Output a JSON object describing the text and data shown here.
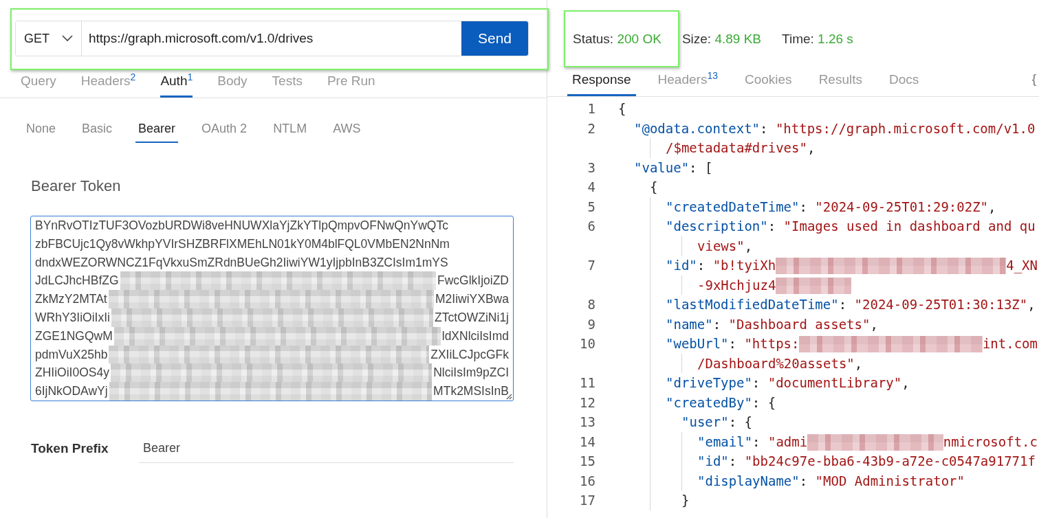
{
  "request": {
    "method": "GET",
    "url": "https://graph.microsoft.com/v1.0/drives",
    "send_label": "Send"
  },
  "request_tabs": [
    {
      "label": "Query",
      "selected": false
    },
    {
      "label": "Headers",
      "badge": "2",
      "selected": false
    },
    {
      "label": "Auth",
      "badge": "1",
      "selected": true
    },
    {
      "label": "Body",
      "selected": false
    },
    {
      "label": "Tests",
      "selected": false
    },
    {
      "label": "Pre Run",
      "selected": false
    }
  ],
  "auth_types": [
    {
      "label": "None",
      "selected": false
    },
    {
      "label": "Basic",
      "selected": false
    },
    {
      "label": "Bearer",
      "selected": true
    },
    {
      "label": "OAuth 2",
      "selected": false
    },
    {
      "label": "NTLM",
      "selected": false
    },
    {
      "label": "AWS",
      "selected": false
    }
  ],
  "bearer": {
    "label": "Bearer Token",
    "token_lines": [
      {
        "text": "BYnRvOTIzTUF3OVozbURDWi8veHNUWXlaYjZkYTlpQmpvOFNwQnYwQTc"
      },
      {
        "text": "zbFBCUjc1Qy8vWkhpYVIrSHZBRFlXMEhLN01kY0M4blFQL0VMbEN2NnNm"
      },
      {
        "text": "dndxWEZORWNCZ1FqVkxuSmZRdnBUeGh2IiwiYW1yIjpbInB3ZCIsIm1mYS"
      },
      {
        "start": "JdLCJhcHBfZG",
        "end": "FwcGlkIjoiZD"
      },
      {
        "start": "ZkMzY2MTAt",
        "end": "M2IiwiYXBwa"
      },
      {
        "start": "WRhY3IiOiIxIi",
        "end": "ZTctOWZiNi1j"
      },
      {
        "start": "ZGE1NGQwM",
        "end": "ldXNlciIsImd"
      },
      {
        "start": "pdmVuX25hb",
        "end": "ZXIiLCJpcGFk"
      },
      {
        "start": "ZHIiOiI0OS4y",
        "end": "NlciIsIm9pZCI"
      },
      {
        "start": "6IjNkODAwYj",
        "end": "MTk2MSIsInB"
      }
    ],
    "prefix_label": "Token Prefix",
    "prefix_value": "Bearer"
  },
  "response": {
    "stats": [
      {
        "label": "Status:",
        "value": "200 OK"
      },
      {
        "label": "Size:",
        "value": "4.89 KB"
      },
      {
        "label": "Time:",
        "value": "1.26 s"
      }
    ],
    "tabs": [
      {
        "label": "Response",
        "selected": true
      },
      {
        "label": "Headers",
        "badge": "13",
        "selected": false
      },
      {
        "label": "Cookies",
        "selected": false
      },
      {
        "label": "Results",
        "selected": false
      },
      {
        "label": "Docs",
        "selected": false
      }
    ],
    "format_button": "{",
    "lines": [
      {
        "num": "1",
        "tokens": [
          {
            "kind": "punc",
            "text": "{"
          }
        ]
      },
      {
        "num": "2",
        "tokens": [
          {
            "kind": "key",
            "text": "  \"@odata.context\""
          },
          {
            "kind": "punc",
            "text": ": "
          },
          {
            "kind": "str",
            "text": "\"https://graph.microsoft.com/v1.0"
          }
        ]
      },
      {
        "tokens": [
          {
            "kind": "str",
            "text": "      /$metadata#drives\""
          },
          {
            "kind": "punc",
            "text": ","
          }
        ]
      },
      {
        "num": "3",
        "tokens": [
          {
            "kind": "key",
            "text": "  \"value\""
          },
          {
            "kind": "punc",
            "text": ": ["
          }
        ]
      },
      {
        "num": "4",
        "tokens": [
          {
            "kind": "punc",
            "text": "    {"
          }
        ]
      },
      {
        "num": "5",
        "tokens": [
          {
            "kind": "key",
            "text": "      \"createdDateTime\""
          },
          {
            "kind": "punc",
            "text": ": "
          },
          {
            "kind": "str",
            "text": "\"2024-09-25T01:29:02Z\""
          },
          {
            "kind": "punc",
            "text": ","
          }
        ]
      },
      {
        "num": "6",
        "tokens": [
          {
            "kind": "key",
            "text": "      \"description\""
          },
          {
            "kind": "punc",
            "text": ": "
          },
          {
            "kind": "str",
            "text": "\"Images used in dashboard and qu"
          }
        ]
      },
      {
        "tokens": [
          {
            "kind": "str",
            "text": "          views\""
          },
          {
            "kind": "punc",
            "text": ","
          }
        ]
      },
      {
        "num": "7",
        "tokens": [
          {
            "kind": "key",
            "text": "      \"id\""
          },
          {
            "kind": "punc",
            "text": ": "
          },
          {
            "kind": "str",
            "text": "\"b!tyiXh"
          },
          {
            "kind": "redacted"
          },
          {
            "kind": "str",
            "text": "4_XN"
          }
        ]
      },
      {
        "tokens": [
          {
            "kind": "str",
            "text": "          -9xHchjuz4"
          },
          {
            "kind": "redacted"
          }
        ]
      },
      {
        "num": "8",
        "tokens": [
          {
            "kind": "key",
            "text": "      \"lastModifiedDateTime\""
          },
          {
            "kind": "punc",
            "text": ": "
          },
          {
            "kind": "str",
            "text": "\"2024-09-25T01:30:13Z\""
          },
          {
            "kind": "punc",
            "text": ","
          }
        ]
      },
      {
        "num": "9",
        "tokens": [
          {
            "kind": "key",
            "text": "      \"name\""
          },
          {
            "kind": "punc",
            "text": ": "
          },
          {
            "kind": "str",
            "text": "\"Dashboard assets\""
          },
          {
            "kind": "punc",
            "text": ","
          }
        ]
      },
      {
        "num": "10",
        "tokens": [
          {
            "kind": "key",
            "text": "      \"webUrl\""
          },
          {
            "kind": "punc",
            "text": ": "
          },
          {
            "kind": "str",
            "text": "\"https:"
          },
          {
            "kind": "redacted"
          },
          {
            "kind": "str",
            "text": "int.com"
          }
        ]
      },
      {
        "tokens": [
          {
            "kind": "str",
            "text": "          /Dashboard%20assets\""
          },
          {
            "kind": "punc",
            "text": ","
          }
        ]
      },
      {
        "num": "11",
        "tokens": [
          {
            "kind": "key",
            "text": "      \"driveType\""
          },
          {
            "kind": "punc",
            "text": ": "
          },
          {
            "kind": "str",
            "text": "\"documentLibrary\""
          },
          {
            "kind": "punc",
            "text": ","
          }
        ]
      },
      {
        "num": "12",
        "tokens": [
          {
            "kind": "key",
            "text": "      \"createdBy\""
          },
          {
            "kind": "punc",
            "text": ": {"
          }
        ]
      },
      {
        "num": "13",
        "tokens": [
          {
            "kind": "key",
            "text": "        \"user\""
          },
          {
            "kind": "punc",
            "text": ": {"
          }
        ]
      },
      {
        "num": "14",
        "tokens": [
          {
            "kind": "key",
            "text": "          \"email\""
          },
          {
            "kind": "punc",
            "text": ": "
          },
          {
            "kind": "str",
            "text": "\"admi"
          },
          {
            "kind": "redacted"
          },
          {
            "kind": "str",
            "text": "nmicrosoft.c"
          }
        ]
      },
      {
        "num": "15",
        "tokens": [
          {
            "kind": "key",
            "text": "          \"id\""
          },
          {
            "kind": "punc",
            "text": ": "
          },
          {
            "kind": "str",
            "text": "\"bb24c97e-bba6-43b9-a72e-c0547a91771f"
          }
        ]
      },
      {
        "num": "16",
        "tokens": [
          {
            "kind": "key",
            "text": "          \"displayName\""
          },
          {
            "kind": "punc",
            "text": ": "
          },
          {
            "kind": "str",
            "text": "\"MOD Administrator\""
          }
        ]
      },
      {
        "num": "17",
        "tokens": [
          {
            "kind": "punc",
            "text": "        }"
          }
        ]
      }
    ]
  }
}
